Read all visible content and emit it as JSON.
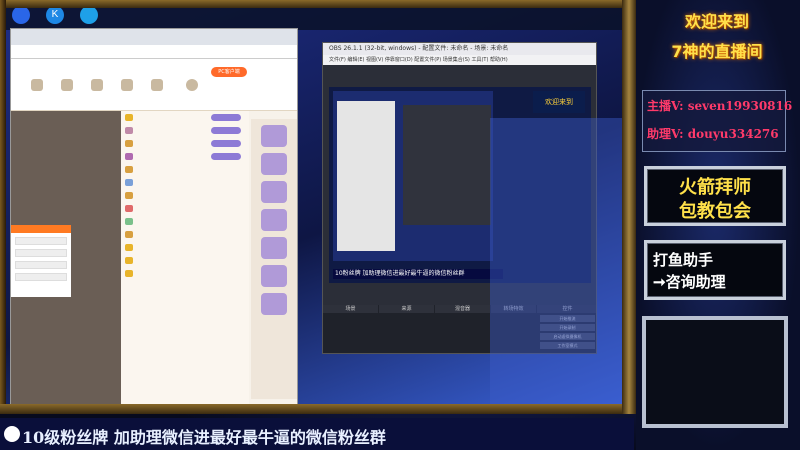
{
  "taskbar": {
    "icons": [
      {
        "name": "app-icon-1",
        "glyph": "",
        "color": "#2a66e8"
      },
      {
        "name": "app-icon-2",
        "glyph": "K",
        "color": "#1e88e5"
      },
      {
        "name": "app-icon-3",
        "glyph": "",
        "color": "#1ea0e8"
      }
    ]
  },
  "overlay": {
    "welcome_line1": "欢迎来到",
    "welcome_line2": "7神的直播间",
    "host_contact": "主播V: seven19930816",
    "assistant_contact": "助理V: douyu334276",
    "rocket_line1": "火箭拜师",
    "rocket_line2": "包教包会",
    "fish_line1": "打鱼助手",
    "fish_line2": "➞咨询助理",
    "ticker": "10级粉丝牌 加助理微信进最好最牛逼的微信粉丝群"
  },
  "obs": {
    "title": "OBS 26.1.1 (32-bit, windows) - 配置文件: 未命名 - 场景: 未命名",
    "menu": "文件(F)  编辑(E)  视图(V)  停靠窗口(D)  配置文件(P)  场景集合(S)  工具(T)  帮助(H)",
    "preview_caption": "10粉丝牌 加助理微信进最好最牛逼的微信粉丝群",
    "preview_banner": "欢迎来到",
    "docks": [
      "场景",
      "来源",
      "混音器",
      "转场特效",
      "控件"
    ],
    "controls": [
      "开始推流",
      "开始录制",
      "启动虚拟摄像机",
      "工作室模式",
      "设置",
      "退出"
    ]
  },
  "browser": {
    "title": "",
    "pc_button": "PC客户端",
    "dialog_label": ""
  },
  "colors": {
    "accent_gold": "#ffe04a",
    "contact_pink": "#ff3a6a",
    "ticker_bg": "#0a0f3a",
    "obs_bg": "#2b2e38"
  }
}
